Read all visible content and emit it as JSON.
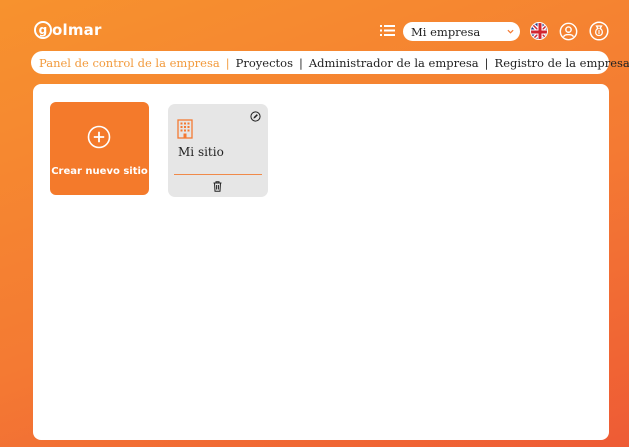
{
  "header": {
    "logo_text": "olmar",
    "logo_letter": "g",
    "company_select": {
      "value": "Mi empresa"
    },
    "icons": [
      "list-icon",
      "uk-flag-icon",
      "user-icon",
      "money-bag-icon"
    ]
  },
  "nav": {
    "items": [
      {
        "label": "Panel de control de la empresa",
        "active": true
      },
      {
        "label": "Proyectos",
        "active": false
      },
      {
        "label": "Administrador de la empresa",
        "active": false
      },
      {
        "label": "Registro de la empresa",
        "active": false
      }
    ],
    "separator": "|"
  },
  "main": {
    "create_card": {
      "label": "Crear nuevo sitio",
      "icon": "plus-circle-icon"
    },
    "sites": [
      {
        "name": "Mi sitio",
        "icon": "building-icon"
      }
    ]
  },
  "colors": {
    "brand": "#f47a33",
    "active_nav": "#f29a3c",
    "card_bg": "#e6e6e6"
  }
}
